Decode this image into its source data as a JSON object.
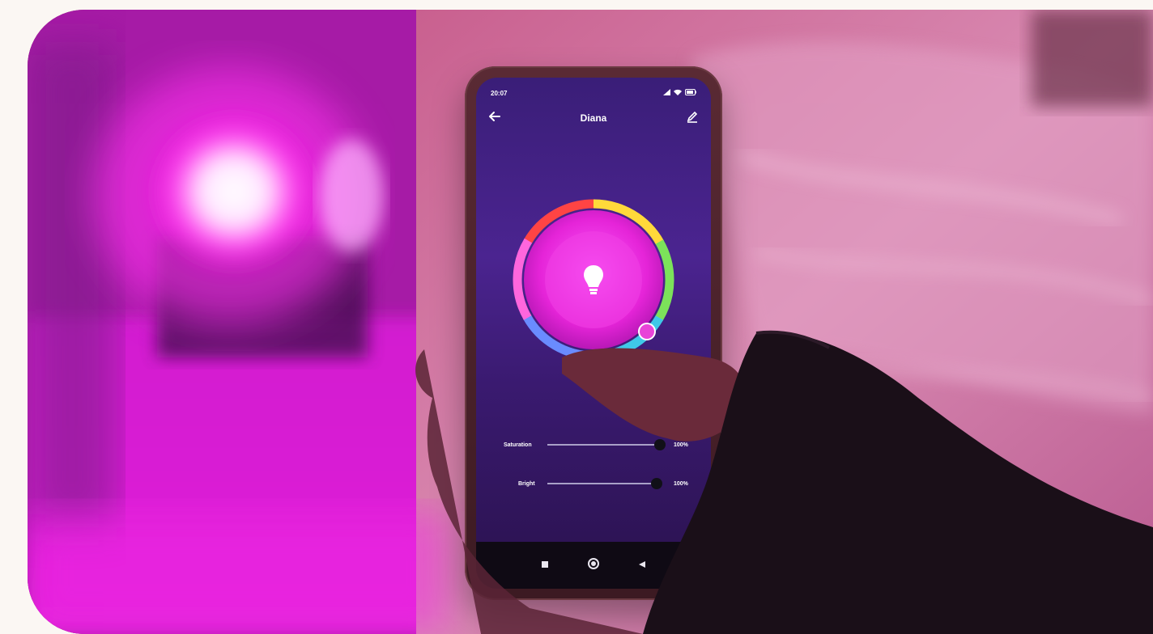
{
  "phone": {
    "status_time": "20:07",
    "app_title": "Diana",
    "sliders": [
      {
        "label": "Saturation",
        "value_text": "100%",
        "fraction": 1.0
      },
      {
        "label": "Bright",
        "value_text": "100%",
        "fraction": 1.0
      }
    ],
    "icons": {
      "back": "arrow-left-icon",
      "edit": "pencil-icon",
      "bulb": "lightbulb-icon",
      "nav_recent": "square-icon",
      "nav_home": "circle-icon",
      "nav_back": "triangle-left-icon"
    }
  },
  "colors": {
    "light_color": "#e63bd6",
    "screen_purple": "#4b2490"
  }
}
